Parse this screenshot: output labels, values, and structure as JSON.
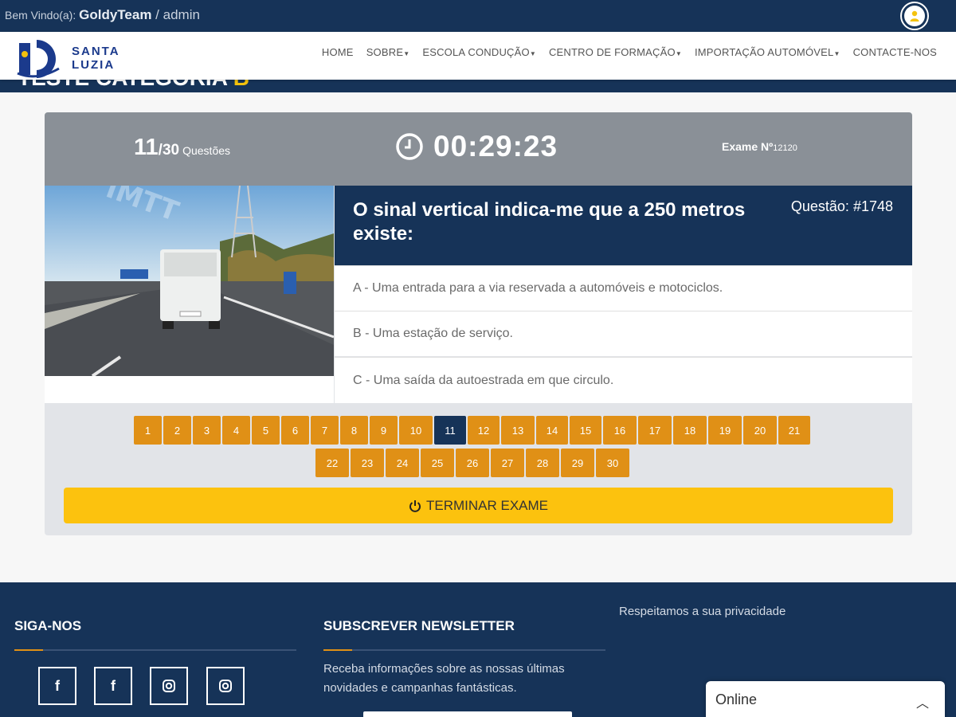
{
  "topbar": {
    "welcome": "Bem Vindo(a)",
    "user": "GoldyTeam",
    "separator": " / ",
    "role": "admin"
  },
  "brand": {
    "line1": "SANTA",
    "line2": "LUZIA"
  },
  "nav": {
    "items": [
      "HOME",
      "SOBRE",
      "ESCOLA CONDUÇÃO",
      "CENTRO DE FORMAÇÃO",
      "IMPORTAÇÃO AUTOMÓVEL",
      "CONTACTE-NOS"
    ],
    "has_caret": [
      false,
      true,
      true,
      true,
      true,
      false
    ]
  },
  "page_header": {
    "title": "TESTE CATEGORIA",
    "category": "B"
  },
  "exam": {
    "current": "11",
    "total": "/30",
    "questions_label": "Questões",
    "timer": "00:29:23",
    "exam_label": "Exame Nº",
    "exam_number": "12120",
    "question_text": "O sinal vertical indica-me que a 250 metros existe:",
    "question_id": "Questão: #1748",
    "answers": [
      "A - Uma entrada para a via reservada a automóveis e motociclos.",
      "B - Uma estação de serviço.",
      "C - Uma saída da autoestrada em que circulo."
    ],
    "photo_watermark": "IMTT",
    "pages": [
      "1",
      "2",
      "3",
      "4",
      "5",
      "6",
      "7",
      "8",
      "9",
      "10",
      "11",
      "12",
      "13",
      "14",
      "15",
      "16",
      "17",
      "18",
      "19",
      "20",
      "21",
      "22",
      "23",
      "24",
      "25",
      "26",
      "27",
      "28",
      "29",
      "30"
    ],
    "active_page": "11",
    "finish_label": "TERMINAR EXAME"
  },
  "footer": {
    "follow_title": "SIGA-NOS",
    "newsletter_title": "SUBSCREVER NEWSLETTER",
    "newsletter_text": "Receba informações sobre as nossas últimas novidades e campanhas fantásticas.",
    "privacy": "Respeitamos a sua privacidade",
    "social_icons": [
      "facebook-icon",
      "facebook-icon",
      "instagram-icon",
      "instagram-icon"
    ]
  },
  "chat": {
    "label": "Online"
  },
  "colors": {
    "navy": "#163358",
    "orange": "#e09016",
    "yellow": "#fcc20e",
    "gray_head": "#8a9097"
  }
}
